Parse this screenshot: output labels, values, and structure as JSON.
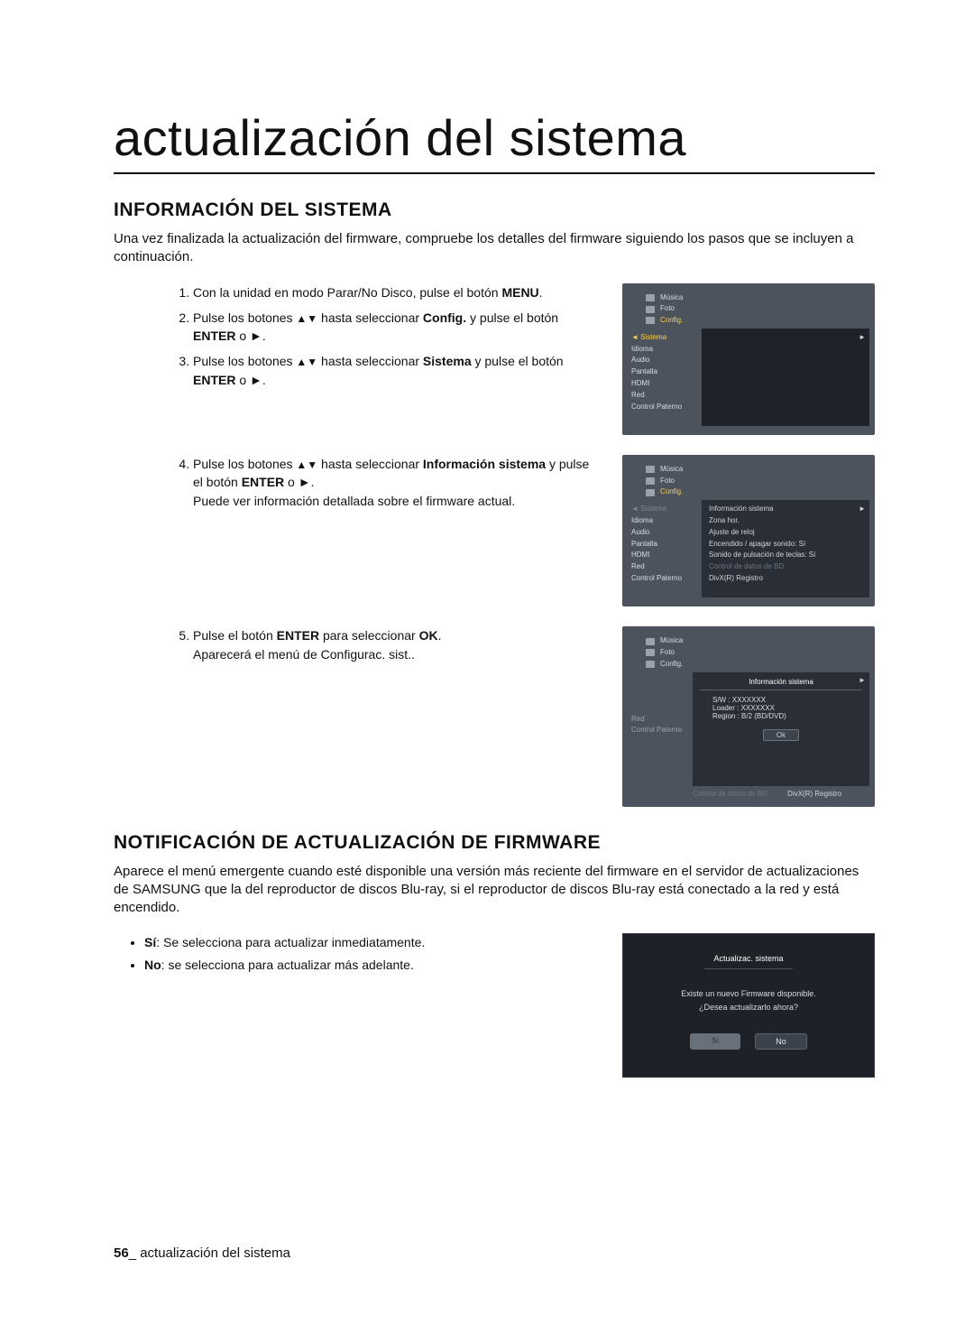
{
  "title": "actualización del sistema",
  "section1": {
    "heading": "INFORMACIÓN DEL SISTEMA",
    "intro": "Una vez finalizada la actualización del firmware, compruebe los detalles del firmware siguiendo los pasos que se incluyen a continuación.",
    "steps": {
      "s1a": "Con la unidad en modo Parar/No Disco, pulse el botón ",
      "s1b": "MENU",
      "s1c": ".",
      "s2a": "Pulse los botones ",
      "s2b": " hasta seleccionar ",
      "s2c": "Config.",
      "s2d": " y pulse el botón ",
      "s2e": "ENTER",
      "s2f": " o ►.",
      "s3a": "Pulse los botones ",
      "s3b": " hasta seleccionar ",
      "s3c": "Sistema",
      "s3d": " y pulse el botón ",
      "s3e": "ENTER",
      "s3f": " o ►.",
      "s4a": "Pulse los botones ",
      "s4b": " hasta seleccionar ",
      "s4c": "Información sistema",
      "s4d": " y pulse el botón ",
      "s4e": "ENTER",
      "s4f": " o ►.",
      "s4g": "Puede ver información detallada sobre el firmware actual.",
      "s5a": "Pulse el botón ",
      "s5b": "ENTER",
      "s5c": " para seleccionar ",
      "s5d": "OK",
      "s5e": ".",
      "s5f": "Aparecerá el menú de Configurac. sist.."
    }
  },
  "section2": {
    "heading": "NOTIFICACIÓN DE ACTUALIZACIÓN DE FIRMWARE",
    "intro": "Aparece el menú emergente cuando esté disponible una versión más reciente del firmware en el servidor de actualizaciones de SAMSUNG que la del reproductor de discos Blu-ray, si el reproductor de discos Blu-ray está conectado a la red y está encendido.",
    "b1a": "Sí",
    "b1b": ": Se selecciona para actualizar inmediatamente.",
    "b2a": "No",
    "b2b": ": se selecciona para actualizar más adelante."
  },
  "screens": {
    "tabs": {
      "musica": "Música",
      "foto": "Foto",
      "config": "Config."
    },
    "side": {
      "sistema": "Sistema",
      "sistema_hl": "◄ Sistema",
      "idioma": "Idioma",
      "audio": "Audio",
      "pantalla": "Pantalla",
      "hdmi": "HDMI",
      "red": "Red",
      "control": "Control Paterno"
    },
    "right": {
      "info": "Información sistema",
      "zona": "Zona hor.",
      "reloj": "Ajuste de reloj",
      "enc": "Encendido / apagar sonido:   Sí",
      "tecla": "Sonido de pulsación de teclas:   Sí",
      "bd_dim": "Control de datos de BD",
      "divx": "DivX(R) Registro",
      "more": "►"
    },
    "popup": {
      "title": "Información sistema",
      "l1": "S/W : XXXXXXX",
      "l2": "Loader : XXXXXXX",
      "l3": "Region : B/2 (BD/DVD)",
      "ok": "Ok",
      "foot_bd": "Control de datos de BD",
      "foot_divx": "DivX(R) Registro"
    },
    "fw": {
      "title": "Actualizac. sistema",
      "line1": "Existe un nuevo Firmware disponible.",
      "line2": "¿Desea actualizarlo ahora?",
      "yes": "Sí",
      "no": "No"
    }
  },
  "footer": {
    "page": "56",
    "sep": "_ ",
    "label": "actualización del sistema"
  }
}
